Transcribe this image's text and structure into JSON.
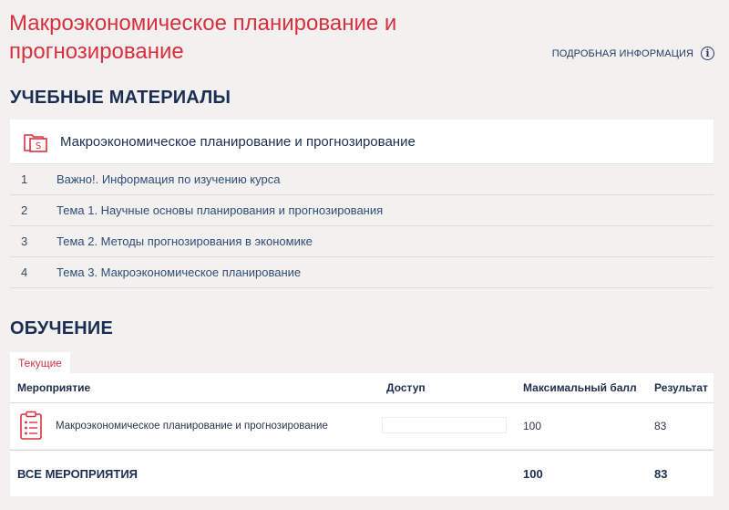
{
  "course": {
    "title": "Макроэкономическое планирование и прогнозирование",
    "info_link": "ПОДРОБНАЯ ИНФОРМАЦИЯ"
  },
  "materials": {
    "heading": "УЧЕБНЫЕ МАТЕРИАЛЫ",
    "card_title": "Макроэкономическое планирование и прогнозирование",
    "items": [
      {
        "num": "1",
        "label": "Важно!. Информация по изучению курса"
      },
      {
        "num": "2",
        "label": "Тема 1. Научные основы планирования и прогнозирования"
      },
      {
        "num": "3",
        "label": "Тема 2. Методы прогнозирования в экономике"
      },
      {
        "num": "4",
        "label": "Тема 3. Макроэкономическое планирование"
      }
    ]
  },
  "training": {
    "heading": "ОБУЧЕНИЕ",
    "tab_label": "Текущие",
    "columns": {
      "event": "Мероприятие",
      "access": "Доступ",
      "max_score": "Максимальный балл",
      "result": "Результат"
    },
    "rows": [
      {
        "name": "Макроэкономическое планирование и прогнозирование",
        "max_score": "100",
        "result": "83"
      }
    ],
    "total": {
      "label": "ВСЕ МЕРОПРИЯТИЯ",
      "max_score": "100",
      "result": "83"
    }
  },
  "colors": {
    "accent_red": "#d8303f",
    "navy": "#1b2d52",
    "background": "#f2f1ef"
  }
}
